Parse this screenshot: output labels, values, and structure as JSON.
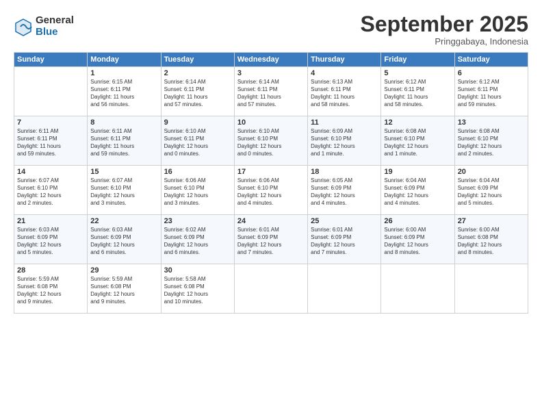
{
  "logo": {
    "general": "General",
    "blue": "Blue"
  },
  "title": "September 2025",
  "subtitle": "Pringgabaya, Indonesia",
  "days": [
    "Sunday",
    "Monday",
    "Tuesday",
    "Wednesday",
    "Thursday",
    "Friday",
    "Saturday"
  ],
  "weeks": [
    [
      {
        "day": "",
        "info": ""
      },
      {
        "day": "1",
        "info": "Sunrise: 6:15 AM\nSunset: 6:11 PM\nDaylight: 11 hours\nand 56 minutes."
      },
      {
        "day": "2",
        "info": "Sunrise: 6:14 AM\nSunset: 6:11 PM\nDaylight: 11 hours\nand 57 minutes."
      },
      {
        "day": "3",
        "info": "Sunrise: 6:14 AM\nSunset: 6:11 PM\nDaylight: 11 hours\nand 57 minutes."
      },
      {
        "day": "4",
        "info": "Sunrise: 6:13 AM\nSunset: 6:11 PM\nDaylight: 11 hours\nand 58 minutes."
      },
      {
        "day": "5",
        "info": "Sunrise: 6:12 AM\nSunset: 6:11 PM\nDaylight: 11 hours\nand 58 minutes."
      },
      {
        "day": "6",
        "info": "Sunrise: 6:12 AM\nSunset: 6:11 PM\nDaylight: 11 hours\nand 59 minutes."
      }
    ],
    [
      {
        "day": "7",
        "info": "Sunrise: 6:11 AM\nSunset: 6:11 PM\nDaylight: 11 hours\nand 59 minutes."
      },
      {
        "day": "8",
        "info": "Sunrise: 6:11 AM\nSunset: 6:11 PM\nDaylight: 11 hours\nand 59 minutes."
      },
      {
        "day": "9",
        "info": "Sunrise: 6:10 AM\nSunset: 6:11 PM\nDaylight: 12 hours\nand 0 minutes."
      },
      {
        "day": "10",
        "info": "Sunrise: 6:10 AM\nSunset: 6:10 PM\nDaylight: 12 hours\nand 0 minutes."
      },
      {
        "day": "11",
        "info": "Sunrise: 6:09 AM\nSunset: 6:10 PM\nDaylight: 12 hours\nand 1 minute."
      },
      {
        "day": "12",
        "info": "Sunrise: 6:08 AM\nSunset: 6:10 PM\nDaylight: 12 hours\nand 1 minute."
      },
      {
        "day": "13",
        "info": "Sunrise: 6:08 AM\nSunset: 6:10 PM\nDaylight: 12 hours\nand 2 minutes."
      }
    ],
    [
      {
        "day": "14",
        "info": "Sunrise: 6:07 AM\nSunset: 6:10 PM\nDaylight: 12 hours\nand 2 minutes."
      },
      {
        "day": "15",
        "info": "Sunrise: 6:07 AM\nSunset: 6:10 PM\nDaylight: 12 hours\nand 3 minutes."
      },
      {
        "day": "16",
        "info": "Sunrise: 6:06 AM\nSunset: 6:10 PM\nDaylight: 12 hours\nand 3 minutes."
      },
      {
        "day": "17",
        "info": "Sunrise: 6:06 AM\nSunset: 6:10 PM\nDaylight: 12 hours\nand 4 minutes."
      },
      {
        "day": "18",
        "info": "Sunrise: 6:05 AM\nSunset: 6:09 PM\nDaylight: 12 hours\nand 4 minutes."
      },
      {
        "day": "19",
        "info": "Sunrise: 6:04 AM\nSunset: 6:09 PM\nDaylight: 12 hours\nand 4 minutes."
      },
      {
        "day": "20",
        "info": "Sunrise: 6:04 AM\nSunset: 6:09 PM\nDaylight: 12 hours\nand 5 minutes."
      }
    ],
    [
      {
        "day": "21",
        "info": "Sunrise: 6:03 AM\nSunset: 6:09 PM\nDaylight: 12 hours\nand 5 minutes."
      },
      {
        "day": "22",
        "info": "Sunrise: 6:03 AM\nSunset: 6:09 PM\nDaylight: 12 hours\nand 6 minutes."
      },
      {
        "day": "23",
        "info": "Sunrise: 6:02 AM\nSunset: 6:09 PM\nDaylight: 12 hours\nand 6 minutes."
      },
      {
        "day": "24",
        "info": "Sunrise: 6:01 AM\nSunset: 6:09 PM\nDaylight: 12 hours\nand 7 minutes."
      },
      {
        "day": "25",
        "info": "Sunrise: 6:01 AM\nSunset: 6:09 PM\nDaylight: 12 hours\nand 7 minutes."
      },
      {
        "day": "26",
        "info": "Sunrise: 6:00 AM\nSunset: 6:09 PM\nDaylight: 12 hours\nand 8 minutes."
      },
      {
        "day": "27",
        "info": "Sunrise: 6:00 AM\nSunset: 6:08 PM\nDaylight: 12 hours\nand 8 minutes."
      }
    ],
    [
      {
        "day": "28",
        "info": "Sunrise: 5:59 AM\nSunset: 6:08 PM\nDaylight: 12 hours\nand 9 minutes."
      },
      {
        "day": "29",
        "info": "Sunrise: 5:59 AM\nSunset: 6:08 PM\nDaylight: 12 hours\nand 9 minutes."
      },
      {
        "day": "30",
        "info": "Sunrise: 5:58 AM\nSunset: 6:08 PM\nDaylight: 12 hours\nand 10 minutes."
      },
      {
        "day": "",
        "info": ""
      },
      {
        "day": "",
        "info": ""
      },
      {
        "day": "",
        "info": ""
      },
      {
        "day": "",
        "info": ""
      }
    ]
  ]
}
